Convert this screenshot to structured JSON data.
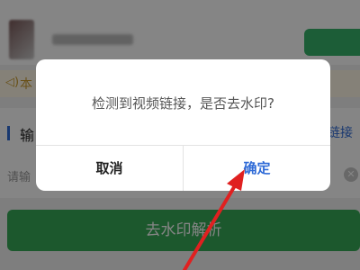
{
  "notice": {
    "icon": "speaker-icon",
    "text": "本"
  },
  "input_section": {
    "title": "输",
    "link": "链接",
    "placeholder": "请输",
    "clear_icon": "clear-icon"
  },
  "parse_button": {
    "label": "去水印解析"
  },
  "dialog": {
    "message": "检测到视频链接，是否去水印?",
    "cancel_label": "取消",
    "confirm_label": "确定"
  },
  "colors": {
    "accent": "#2f6bd7",
    "primary_green": "#37a957",
    "annotation_arrow": "#e02020"
  }
}
